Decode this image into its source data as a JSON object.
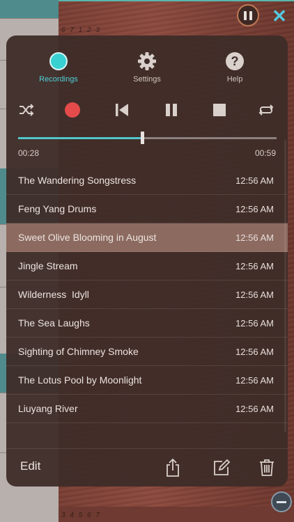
{
  "tabs": [
    {
      "label": "Recordings",
      "icon": "record-icon",
      "active": true
    },
    {
      "label": "Settings",
      "icon": "gear-icon",
      "active": false
    },
    {
      "label": "Help",
      "icon": "help-icon",
      "active": false
    }
  ],
  "controls": [
    "shuffle-icon",
    "record-icon",
    "skip-back-icon",
    "pause-icon",
    "stop-icon",
    "repeat-icon"
  ],
  "playback": {
    "elapsed": "00:28",
    "duration": "00:59",
    "progress_fraction": 0.48
  },
  "recordings": [
    {
      "title": "The Wandering Songstress",
      "time": "12:56 AM"
    },
    {
      "title": "Feng Yang Drums",
      "time": "12:56 AM"
    },
    {
      "title": "Sweet Olive Blooming in August",
      "time": "12:56 AM",
      "selected": true
    },
    {
      "title": "Jingle Stream",
      "time": "12:56 AM"
    },
    {
      "title": "Wilderness  Idyll",
      "time": "12:56 AM"
    },
    {
      "title": "The Sea Laughs",
      "time": "12:56 AM"
    },
    {
      "title": "Sighting of Chimney Smoke",
      "time": "12:56 AM"
    },
    {
      "title": "The Lotus Pool by Moonlight",
      "time": "12:56 AM"
    },
    {
      "title": "Liuyang River",
      "time": "12:56 AM"
    }
  ],
  "footer": {
    "edit_label": "Edit"
  },
  "background": {
    "top_numbers": "6 7 1 2 3",
    "bottom_numbers": "3 4 5 6 7"
  },
  "colors": {
    "accent": "#4fd0d8",
    "record": "#e54b4b",
    "selected_row": "#8c6a60",
    "panel": "#3e2c28"
  }
}
